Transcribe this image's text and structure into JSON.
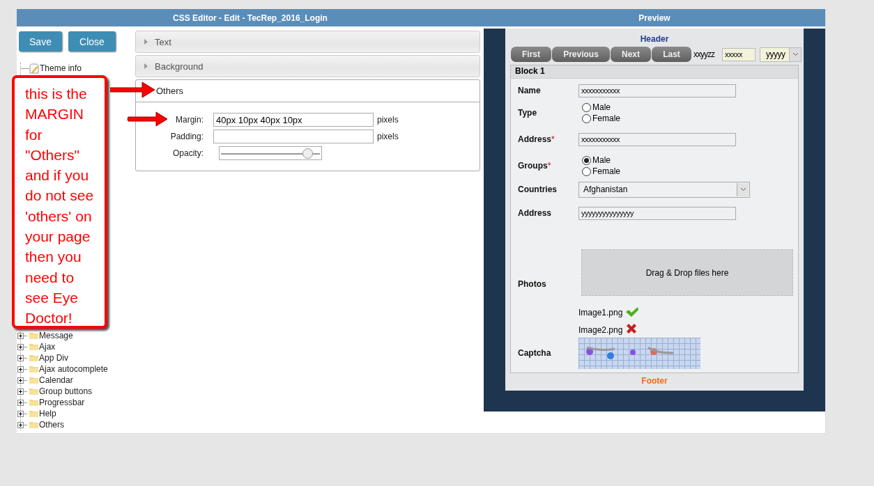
{
  "window": {
    "editor_title": "CSS Editor - Edit - TecRep_2016_Login",
    "preview_title": "Preview"
  },
  "buttons": [
    "Save",
    "Close"
  ],
  "tree": [
    {
      "label": "Theme info",
      "kind": "page"
    },
    {
      "label": "Message",
      "kind": "folder",
      "expanded": false
    },
    {
      "label": "Ajax",
      "kind": "folder",
      "expanded": false
    },
    {
      "label": "App Div",
      "kind": "folder",
      "expanded": false
    },
    {
      "label": "Ajax autocomplete",
      "kind": "folder",
      "expanded": false
    },
    {
      "label": "Calendar",
      "kind": "folder",
      "expanded": false
    },
    {
      "label": "Group buttons",
      "kind": "folder",
      "expanded": false
    },
    {
      "label": "Progressbar",
      "kind": "folder",
      "expanded": false
    },
    {
      "label": "Help",
      "kind": "folder",
      "expanded": false
    },
    {
      "label": "Others",
      "kind": "folder",
      "expanded": false
    }
  ],
  "callout": {
    "text": "this is the MARGIN for \"Others\" and if you do not see 'others' on your page then you need to see Eye Doctor!"
  },
  "accordion": [
    {
      "title": "Text",
      "expanded": false
    },
    {
      "title": "Background",
      "expanded": false
    },
    {
      "title": "Others",
      "expanded": true,
      "fields": [
        {
          "kind": "text",
          "label": "Margin:",
          "value": "40px 10px 40px 10px",
          "unit": "pixels"
        },
        {
          "kind": "text",
          "label": "Padding:",
          "unit": "pixels"
        },
        {
          "kind": "slider",
          "label": "Opacity:",
          "level": 0.9
        }
      ]
    }
  ],
  "preview": {
    "header": "Header",
    "pager": {
      "buttons": [
        "First",
        "Previous",
        "Next",
        "Last"
      ],
      "text": "xxyyzz",
      "input": "xxxxx",
      "select": "yyyyy"
    },
    "block_title": "Block 1",
    "rows": [
      {
        "kind": "text",
        "label": "Name",
        "value": "xxxxxxxxxxx"
      },
      {
        "kind": "radio",
        "label": "Type",
        "options": [
          {
            "label": "Male",
            "selected": false
          },
          {
            "label": "Female",
            "selected": false
          }
        ]
      },
      {
        "kind": "text",
        "label": "Address",
        "required_marker": "*",
        "value": "xxxxxxxxxxx"
      },
      {
        "kind": "radio",
        "label": "Groups",
        "required_marker": "*",
        "options": [
          {
            "label": "Male",
            "selected": true
          },
          {
            "label": "Female",
            "selected": false
          }
        ]
      },
      {
        "kind": "select",
        "label": "Countries",
        "value": "Afghanistan"
      },
      {
        "kind": "text",
        "label": "Address",
        "value": "yyyyyyyyyyyyyyy"
      },
      {
        "kind": "upload",
        "label": "Photos",
        "dropzone": "Drag & Drop files here",
        "files": [
          {
            "name": "Image1.png",
            "kind": "ok"
          },
          {
            "name": "Image2.png",
            "kind": "error"
          }
        ]
      },
      {
        "kind": "captcha",
        "label": "Captcha"
      }
    ],
    "footer": "Footer"
  }
}
